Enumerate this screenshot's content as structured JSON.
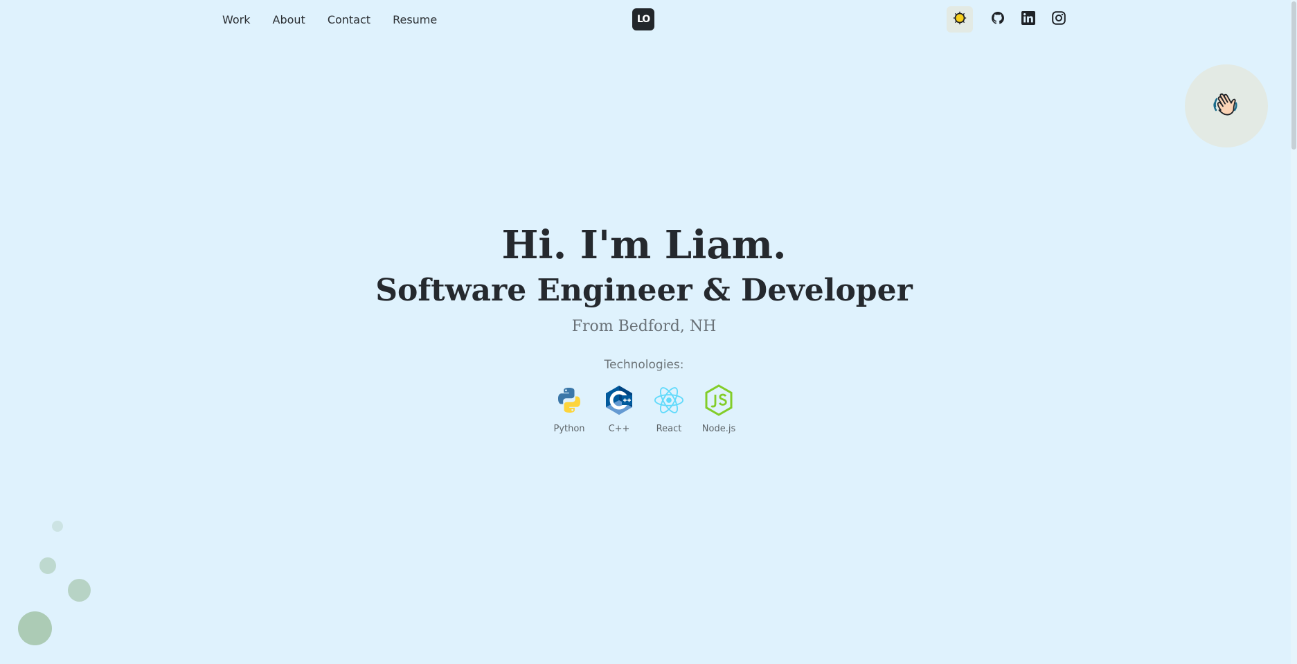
{
  "nav": {
    "links": [
      "Work",
      "About",
      "Contact",
      "Resume"
    ],
    "logo_text": "LO"
  },
  "header_icons": [
    "sun-icon",
    "github-icon",
    "linkedin-icon",
    "instagram-icon"
  ],
  "wave_icon": "waving-hand-icon",
  "hero": {
    "title": "Hi. I'm Liam.",
    "subtitle": "Software Engineer & Developer",
    "location": "From Bedford, NH"
  },
  "technologies": {
    "label": "Technologies:",
    "items": [
      {
        "name": "Python",
        "icon": "python-icon"
      },
      {
        "name": "C++",
        "icon": "cplusplus-icon"
      },
      {
        "name": "React",
        "icon": "react-icon"
      },
      {
        "name": "Node.js",
        "icon": "nodejs-icon"
      }
    ]
  },
  "colors": {
    "background": "#dff2fd",
    "bubble": "#a9c8b1",
    "text_dark": "#25292e"
  }
}
